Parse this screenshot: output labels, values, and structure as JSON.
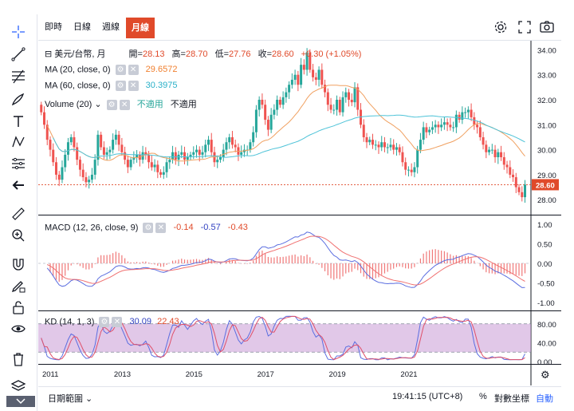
{
  "tabs": [
    {
      "label": "即時",
      "active": false
    },
    {
      "label": "日線",
      "active": false
    },
    {
      "label": "週線",
      "active": false
    },
    {
      "label": "月線",
      "active": true
    }
  ],
  "header_icons": [
    "gear-icon",
    "fullscreen-icon",
    "camera-icon"
  ],
  "left_tools": [
    "crosshair-icon",
    "trend-line-icon",
    "fib-icon",
    "brush-icon",
    "text-icon",
    "pattern-icon",
    "prediction-icon",
    "back-arrow-icon",
    "ruler-icon",
    "zoom-in-icon",
    "magnet-icon",
    "lock-draw-icon",
    "lock-icon",
    "eye-icon",
    "trash-icon",
    "layers-icon"
  ],
  "legend": {
    "symbol": "美元/台幣, 月",
    "open_label": "開=",
    "open": "28.13",
    "high_label": "高=",
    "high": "28.70",
    "low_label": "低=",
    "low": "27.76",
    "close_label": "收=",
    "close": "28.60",
    "change": "+0.30 (+1.05%)",
    "ma20_label": "MA (20, close, 0)",
    "ma20_value": "29.6572",
    "ma60_label": "MA (60, close, 0)",
    "ma60_value": "30.3975",
    "volume_label": "Volume (20)",
    "volume_value1": "不適用",
    "volume_value2": "不適用",
    "macd_label": "MACD (12, 26, close, 9)",
    "macd_v1": "-0.14",
    "macd_v2": "-0.57",
    "macd_v3": "-0.43",
    "kd_label": "KD (14, 1, 3)",
    "kd_v1": "30.09",
    "kd_v2": "22.43"
  },
  "colors": {
    "up": "#26a69a",
    "down": "#ef5350",
    "ma20": "#f0a060",
    "ma60": "#4ec3d8",
    "macd_line": "#5b6ee0",
    "signal": "#f07070",
    "k": "#5b6ee0",
    "d": "#e0506a",
    "kd_band": "#c99ad6",
    "accent": "#e04a2a"
  },
  "bottom": {
    "range_label": "日期範圍",
    "time": "19:41:15 (UTC+8)",
    "pct": "%",
    "log": "對數坐標",
    "auto": "自動"
  },
  "chart_data": {
    "type": "candlestick",
    "x_ticks": [
      "2011",
      "2013",
      "2015",
      "2017",
      "2019",
      "2021"
    ],
    "price_axis": {
      "ticks": [
        "34.00",
        "33.00",
        "32.00",
        "31.00",
        "30.00",
        "29.00",
        "28.00"
      ],
      "last": "28.60",
      "ylim": [
        27.4,
        34.3
      ]
    },
    "macd_axis": {
      "ticks": [
        "1.00",
        "0.50",
        "0.00",
        "-0.50",
        "-1.00"
      ],
      "ylim": [
        -1.2,
        1.2
      ]
    },
    "kd_axis": {
      "ticks": [
        "80.00",
        "40.00",
        "0.00"
      ],
      "ylim": [
        -5,
        105
      ],
      "band": [
        20,
        80
      ]
    },
    "closes": [
      31.5,
      31.0,
      30.4,
      30.0,
      29.5,
      29.0,
      28.8,
      29.3,
      29.8,
      30.3,
      30.5,
      30.1,
      29.6,
      29.2,
      28.9,
      28.7,
      28.8,
      29.0,
      29.6,
      30.6,
      30.1,
      29.8,
      29.9,
      30.0,
      30.4,
      30.6,
      30.2,
      29.9,
      29.6,
      29.3,
      29.6,
      29.7,
      29.8,
      29.6,
      29.9,
      29.8,
      29.5,
      29.3,
      29.4,
      29.1,
      29.0,
      29.1,
      29.5,
      29.6,
      29.9,
      29.6,
      29.8,
      29.9,
      29.6,
      29.7,
      29.8,
      29.9,
      30.0,
      29.8,
      29.9,
      30.2,
      30.4,
      29.9,
      29.5,
      29.6,
      29.7,
      30.0,
      30.3,
      30.5,
      30.2,
      30.1,
      29.8,
      29.9,
      30.0,
      30.0,
      30.3,
      30.7,
      31.6,
      32.0,
      31.8,
      31.2,
      30.8,
      31.4,
      31.6,
      32.0,
      31.8,
      32.1,
      32.3,
      32.6,
      32.8,
      33.0,
      32.6,
      33.4,
      33.2,
      33.9,
      33.2,
      32.9,
      32.8,
      33.2,
      32.6,
      32.3,
      31.8,
      31.6,
      31.6,
      32.0,
      31.5,
      32.1,
      32.3,
      32.0,
      31.9,
      32.5,
      31.6,
      31.0,
      30.5,
      30.3,
      30.4,
      30.2,
      30.2,
      30.1,
      30.3,
      30.1,
      30.1,
      30.2,
      30.0,
      30.1,
      29.9,
      29.5,
      29.2,
      29.2,
      29.1,
      29.3,
      30.0,
      30.4,
      30.9,
      30.7,
      30.8,
      30.9,
      31.0,
      30.9,
      31.0,
      31.1,
      31.0,
      30.9,
      30.9,
      31.4,
      31.2,
      31.5,
      31.5,
      31.6,
      31.3,
      31.0,
      30.9,
      30.5,
      30.2,
      29.9,
      30.0,
      30.0,
      29.7,
      29.9,
      29.7,
      29.4,
      29.3,
      29.0,
      28.9,
      28.5,
      28.3,
      28.1,
      28.6
    ]
  }
}
